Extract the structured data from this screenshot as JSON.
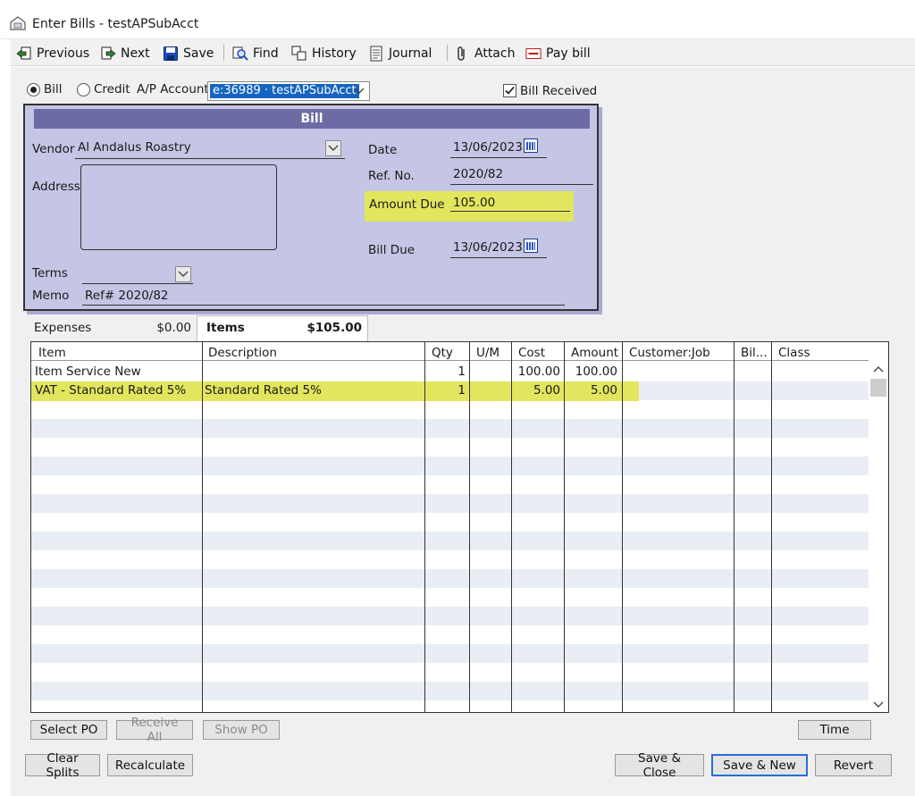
{
  "window": {
    "title": "Enter Bills - testAPSubAcct"
  },
  "toolbar": {
    "previous": "Previous",
    "next": "Next",
    "save": "Save",
    "find": "Find",
    "history": "History",
    "journal": "Journal",
    "attach": "Attach",
    "pay_bill": "Pay bill"
  },
  "header": {
    "bill_radio": "Bill",
    "credit_radio": "Credit",
    "ap_account_label": "A/P Account",
    "ap_account_value": "e:36989 · testAPSubAcct",
    "bill_received": "Bill Received"
  },
  "bill": {
    "panel_title": "Bill",
    "vendor_label": "Vendor",
    "vendor_value": "Al Andalus Roastry",
    "address_label": "Address",
    "terms_label": "Terms",
    "terms_value": "",
    "memo_label": "Memo",
    "memo_value": "Ref# 2020/82",
    "date_label": "Date",
    "date_value": "13/06/2023",
    "ref_label": "Ref. No.",
    "ref_value": "2020/82",
    "amount_due_label": "Amount Due",
    "amount_due_value": "105.00",
    "bill_due_label": "Bill Due",
    "bill_due_value": "13/06/2023"
  },
  "tabs": {
    "expenses_label": "Expenses",
    "expenses_amount": "$0.00",
    "items_label": "Items",
    "items_amount": "$105.00"
  },
  "grid": {
    "columns": [
      "Item",
      "Description",
      "Qty",
      "U/M",
      "Cost",
      "Amount",
      "Customer:Job",
      "Bil...",
      "Class"
    ],
    "rows": [
      {
        "item": "Item Service New",
        "description": "",
        "qty": "1",
        "um": "",
        "cost": "100.00",
        "amount": "100.00"
      },
      {
        "item": "VAT - Standard Rated 5%",
        "description": "Standard Rated 5%",
        "qty": "1",
        "um": "",
        "cost": "5.00",
        "amount": "5.00"
      }
    ]
  },
  "buttons": {
    "select_po": "Select PO",
    "receive_all": "Receive All",
    "show_po": "Show PO",
    "time": "Time",
    "clear_splits": "Clear Splits",
    "recalculate": "Recalculate",
    "save_close": "Save & Close",
    "save_new": "Save & New",
    "revert": "Revert"
  },
  "colors": {
    "panel": "#c5c5e5",
    "panel_header": "#6b6ba6",
    "highlight": "#e1e65e",
    "selection": "#1565c0"
  }
}
